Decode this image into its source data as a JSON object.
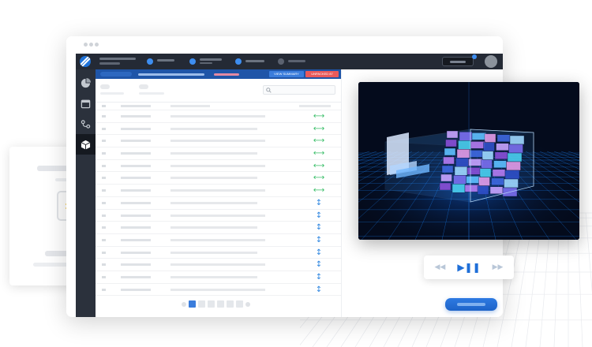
{
  "header": {
    "buttons": {
      "view_summary": "VIEW SUMMARY",
      "unpacked": "UNPACKED 87"
    }
  },
  "icons": {
    "logo": "logo-icon",
    "sidebar": [
      "pie-chart-icon",
      "calendar-icon",
      "route-icon",
      "box-icon"
    ],
    "player": [
      "rewind-icon",
      "play-pause-icon",
      "fast-forward-icon"
    ]
  },
  "player": {
    "rewind": "◀◀",
    "play": "▶❚❚",
    "forward": "▶▶"
  },
  "table": {
    "orientation": [
      "horizontal",
      "horizontal",
      "horizontal",
      "horizontal",
      "horizontal",
      "horizontal",
      "horizontal",
      "vertical",
      "vertical",
      "vertical",
      "vertical",
      "vertical",
      "vertical",
      "vertical",
      "vertical"
    ],
    "orientation_glyphs": {
      "horizontal": "⟷",
      "vertical": "↕"
    }
  },
  "pagination": {
    "current_page": 1
  },
  "colors": {
    "accent": "#1f72d8",
    "topbar": "#242a35",
    "sidebar": "#2b313c",
    "header_bar": "#1f55a8",
    "danger": "#ea5a5a",
    "success": "#3bbf6a",
    "scene_background": "#040b1c",
    "scene_grid": "#1a86ff"
  }
}
